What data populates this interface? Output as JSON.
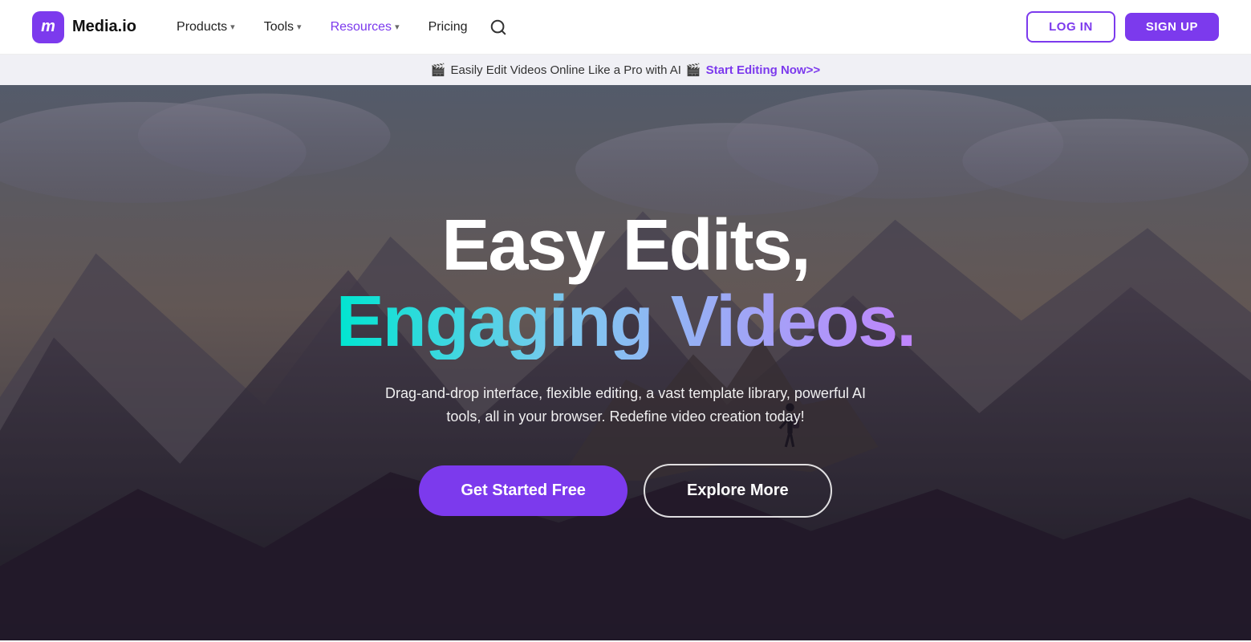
{
  "navbar": {
    "logo": {
      "icon": "m",
      "text": "Media.io"
    },
    "nav_items": [
      {
        "label": "Products",
        "has_chevron": true,
        "active": false
      },
      {
        "label": "Tools",
        "has_chevron": true,
        "active": false
      },
      {
        "label": "Resources",
        "has_chevron": true,
        "active": true
      },
      {
        "label": "Pricing",
        "has_chevron": false,
        "active": false
      }
    ],
    "login_label": "LOG IN",
    "signup_label": "SIGN UP"
  },
  "announcement": {
    "prefix_emoji": "🎬",
    "text": "Easily Edit Videos Online Like a Pro with AI",
    "suffix_emoji": "🎬",
    "cta_label": "Start Editing Now>>"
  },
  "hero": {
    "title_line1": "Easy Edits,",
    "title_line2": "Engaging Videos.",
    "subtitle": "Drag-and-drop interface, flexible editing, a vast template library, powerful AI tools, all in your browser. Redefine video creation today!",
    "btn_primary": "Get Started Free",
    "btn_secondary": "Explore More"
  }
}
